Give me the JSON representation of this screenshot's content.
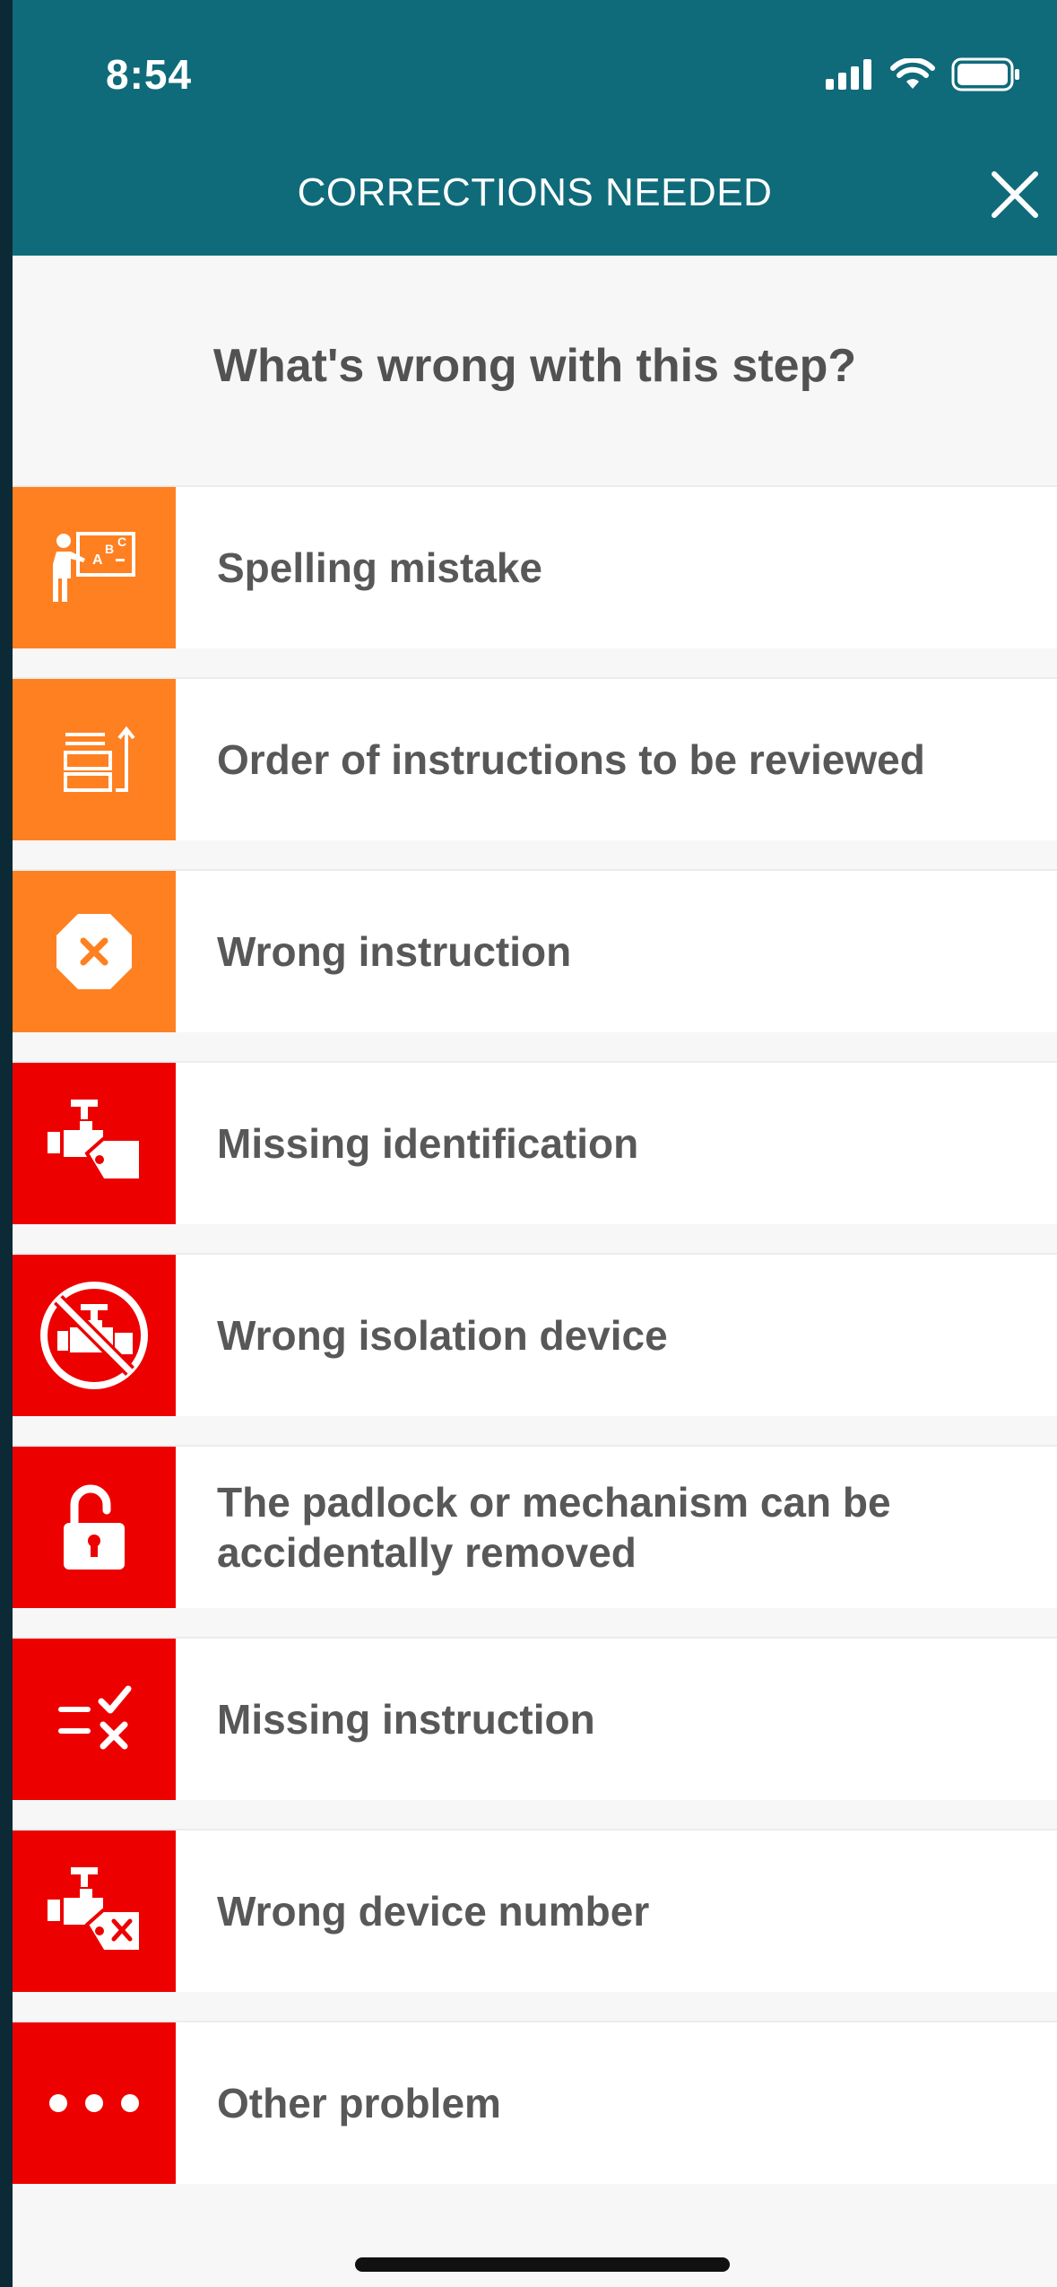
{
  "status_bar": {
    "time": "8:54"
  },
  "header": {
    "title": "CORRECTIONS NEEDED"
  },
  "question": "What's wrong with this step?",
  "options": [
    {
      "label": "Spelling mistake",
      "color": "#ff8021",
      "icon": "teacher-board-icon"
    },
    {
      "label": "Order of instructions to be reviewed",
      "color": "#ff8021",
      "icon": "reorder-list-icon"
    },
    {
      "label": "Wrong instruction",
      "color": "#ff8021",
      "icon": "octagon-x-icon"
    },
    {
      "label": "Missing identification",
      "color": "#ec0000",
      "icon": "valve-tag-icon"
    },
    {
      "label": "Wrong isolation device",
      "color": "#ec0000",
      "icon": "prohibited-valve-icon"
    },
    {
      "label": "The padlock or mechanism can be accidentally removed",
      "color": "#ec0000",
      "icon": "open-padlock-icon"
    },
    {
      "label": "Missing instruction",
      "color": "#ec0000",
      "icon": "checklist-x-icon"
    },
    {
      "label": "Wrong device number",
      "color": "#ec0000",
      "icon": "valve-tag-x-icon"
    },
    {
      "label": "Other problem",
      "color": "#ec0000",
      "icon": "more-dots-icon"
    }
  ]
}
